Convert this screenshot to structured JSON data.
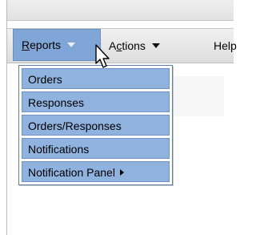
{
  "menubar": {
    "reports": {
      "label_u": "R",
      "label_rest": "eports"
    },
    "actions": {
      "label_pre": "A",
      "label_u": "c",
      "label_rest": "tions"
    },
    "help": {
      "label": "Help"
    }
  },
  "dropdown": {
    "items": [
      {
        "label": "Orders"
      },
      {
        "label": "Responses"
      },
      {
        "label": "Orders/Responses"
      },
      {
        "label": "Notifications"
      },
      {
        "label": "Notification Panel",
        "submenu_icon": "submenu-arrow-icon"
      }
    ]
  },
  "colors": {
    "highlight": "#7fa6d6",
    "menu_item_bg": "#8fb2df",
    "border": "#5b7fb0"
  }
}
